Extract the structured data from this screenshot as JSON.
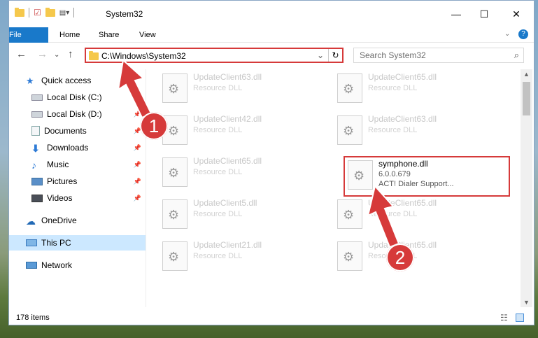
{
  "window": {
    "title": "System32"
  },
  "controls": {
    "minimize": "—",
    "maximize": "☐",
    "close": "✕"
  },
  "ribbon": {
    "tabs": [
      "File",
      "Home",
      "Share",
      "View"
    ]
  },
  "address": {
    "path": "C:\\Windows\\System32"
  },
  "search": {
    "placeholder": "Search System32"
  },
  "nav_items": [
    {
      "label": "Quick access",
      "icon": "star-icon"
    },
    {
      "label": "Local Disk (C:)",
      "icon": "drive-icon"
    },
    {
      "label": "Local Disk (D:)",
      "icon": "drive-icon"
    },
    {
      "label": "Documents",
      "icon": "documents-icon"
    },
    {
      "label": "Downloads",
      "icon": "downloads-icon"
    },
    {
      "label": "Music",
      "icon": "music-icon"
    },
    {
      "label": "Pictures",
      "icon": "pictures-icon"
    },
    {
      "label": "Videos",
      "icon": "videos-icon"
    },
    {
      "label": "OneDrive",
      "icon": "cloud-icon"
    },
    {
      "label": "This PC",
      "icon": "computer-icon"
    },
    {
      "label": "Network",
      "icon": "network-icon"
    }
  ],
  "files": [
    {
      "name": "UpdateClient63.dll",
      "sub": "Resource DLL"
    },
    {
      "name": "UpdateClient65.dll",
      "sub": "Resource DLL"
    },
    {
      "name": "UpdateClient42.dll",
      "sub": "Resource DLL"
    },
    {
      "name": "UpdateClient63.dll",
      "sub": "Resource DLL"
    },
    {
      "name": "UpdateClient65.dll",
      "sub": "Resource DLL"
    },
    {
      "name": "symphone.dll",
      "sub": "6.0.0.679",
      "sub2": "ACT! Dialer Support..."
    },
    {
      "name": "UpdateClient5.dll",
      "sub": "Resource DLL"
    },
    {
      "name": "UpdateClient65.dll",
      "sub": "Resource DLL"
    },
    {
      "name": "UpdateClient21.dll",
      "sub": "Resource DLL"
    },
    {
      "name": "UpdateClient65.dll",
      "sub": "Resource DLL"
    }
  ],
  "status": {
    "count": "178 items"
  },
  "annotations": {
    "step1": "1",
    "step2": "2"
  },
  "colors": {
    "accent": "#1979ca",
    "highlight": "#d63a3a"
  }
}
